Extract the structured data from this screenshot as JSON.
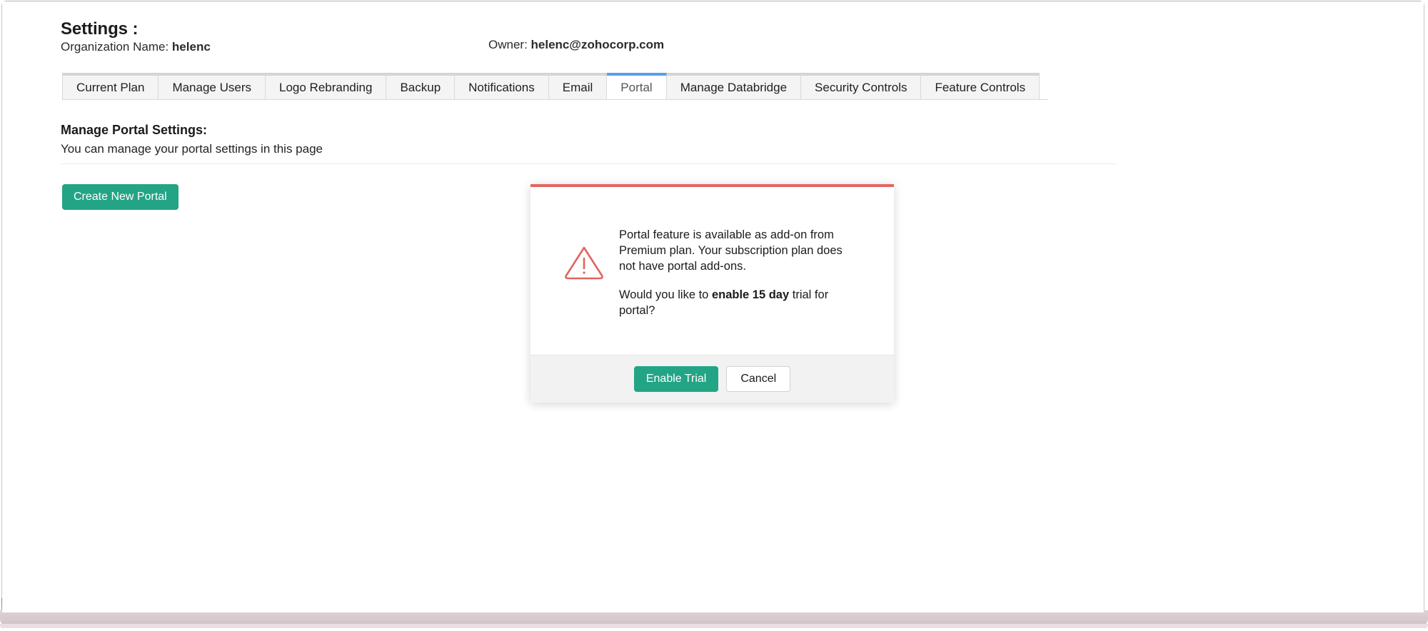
{
  "header": {
    "title": "Settings :",
    "org_label": "Organization Name:",
    "org_value": "helenc",
    "owner_label": "Owner:",
    "owner_value": "helenc@zohocorp.com"
  },
  "tabs": {
    "active_index": 6,
    "items": [
      {
        "label": "Current Plan"
      },
      {
        "label": "Manage Users"
      },
      {
        "label": "Logo Rebranding"
      },
      {
        "label": "Backup"
      },
      {
        "label": "Notifications"
      },
      {
        "label": "Email"
      },
      {
        "label": "Portal"
      },
      {
        "label": "Manage Databridge"
      },
      {
        "label": "Security Controls"
      },
      {
        "label": "Feature Controls"
      }
    ]
  },
  "main": {
    "section_title": "Manage Portal Settings:",
    "section_desc": "You can manage your portal settings in this page",
    "create_portal_label": "Create New Portal"
  },
  "dialog": {
    "icon": "warning-triangle-icon",
    "close_icon": "close-icon",
    "message_line1": "Portal feature is available as add-on from Premium plan. Your subscription plan does not have portal add-ons.",
    "message_line2_prefix": "Would you like to ",
    "message_line2_bold": "enable 15 day",
    "message_line2_suffix": " trial for portal?",
    "primary_label": "Enable Trial",
    "secondary_label": "Cancel"
  },
  "colors": {
    "accent_green": "#23a485",
    "active_tab_blue": "#5d9cec",
    "warning_red": "#e4645f",
    "footer_gray": "#f2f2f2"
  }
}
